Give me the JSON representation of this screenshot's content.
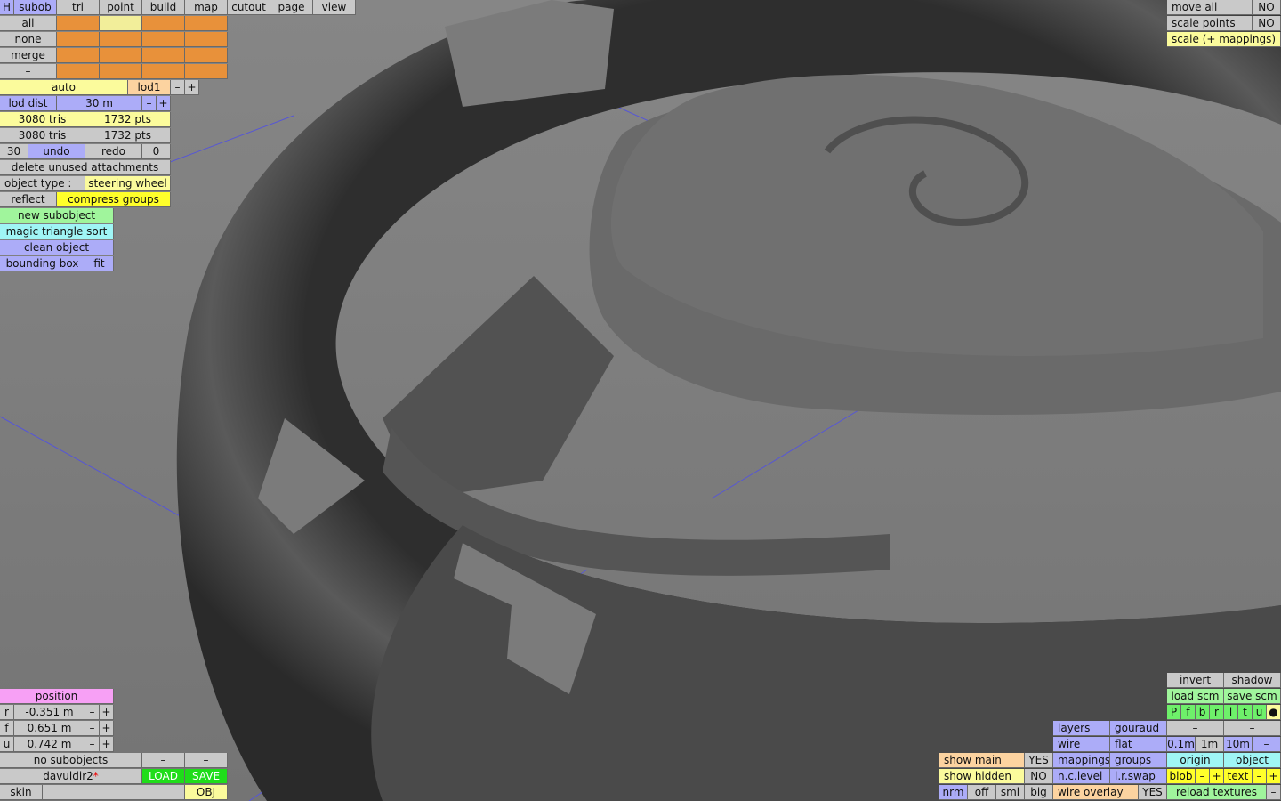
{
  "menu": {
    "items": [
      "H",
      "subob",
      "tri",
      "point",
      "build",
      "map",
      "cutout",
      "page",
      "view"
    ]
  },
  "subob_panel": {
    "rows": [
      "all",
      "none",
      "merge",
      "–"
    ]
  },
  "lod": {
    "auto": "auto",
    "lod1": "lod1",
    "minus": "–",
    "plus": "+",
    "dist_label": "lod dist",
    "dist_value": "30 m"
  },
  "stats": {
    "tris1": "3080 tris",
    "pts1": "1732 pts",
    "tris2": "3080 tris",
    "pts2": "1732 pts"
  },
  "history": {
    "undo_count": "30",
    "undo": "undo",
    "redo": "redo",
    "redo_count": "0"
  },
  "actions": {
    "delete_unused": "delete unused attachments",
    "object_type_label": "object type :",
    "object_type_value": "steering wheel",
    "reflect": "reflect",
    "compress_groups": "compress groups",
    "new_subobject": "new subobject",
    "magic_sort": "magic triangle sort",
    "clean_object": "clean object",
    "bounding_box": "bounding box",
    "fit": "fit"
  },
  "top_right": {
    "move_all": "move all",
    "move_all_value": "NO",
    "scale_points": "scale points",
    "scale_points_value": "NO",
    "scale_mappings": "scale (+ mappings)"
  },
  "position": {
    "title": "position",
    "rows": [
      {
        "axis": "r",
        "value": "-0.351 m"
      },
      {
        "axis": "f",
        "value": "0.651 m"
      },
      {
        "axis": "u",
        "value": "0.742 m"
      }
    ],
    "minus": "–",
    "plus": "+"
  },
  "bottom_left": {
    "no_subobjects": "no subobjects",
    "dash1": "–",
    "dash2": "–",
    "filename": "davuldir2",
    "modified_marker": "*",
    "load": "LOAD",
    "save": "SAVE",
    "skin": "skin",
    "obj": "OBJ"
  },
  "bottom_mid": {
    "show_main": "show main",
    "show_main_value": "YES",
    "show_hidden": "show hidden",
    "show_hidden_value": "NO",
    "nrm": "nrm",
    "off": "off",
    "sml": "sml",
    "big": "big"
  },
  "render_modes": {
    "layers": "layers",
    "gouraud": "gouraud",
    "wire": "wire",
    "flat": "flat",
    "mappings": "mappings",
    "groups": "groups",
    "nc_level": "n.c.level",
    "lr_swap": "l.r.swap",
    "wire_overlay": "wire overlay",
    "wire_overlay_value": "YES"
  },
  "bottom_right": {
    "invert": "invert",
    "shadow": "shadow",
    "load_scm": "load scm",
    "save_scm": "save scm",
    "flags": [
      "P",
      "f",
      "b",
      "r",
      "l",
      "t",
      "u",
      "●"
    ],
    "dash_a": "–",
    "dash_b": "–",
    "grid": [
      "0.1m",
      "1m",
      "10m",
      "–"
    ],
    "origin": "origin",
    "object": "object",
    "blob": "blob",
    "blob_minus": "–",
    "blob_plus": "+",
    "text": "text",
    "text_minus": "–",
    "text_plus": "+",
    "reload_textures": "reload textures",
    "reload_minus": "–"
  },
  "colors": {
    "viewport_bg": "#7d7d7d",
    "wheel_dark": "#3c3c3c",
    "axis_line": "#5a5ad8"
  }
}
